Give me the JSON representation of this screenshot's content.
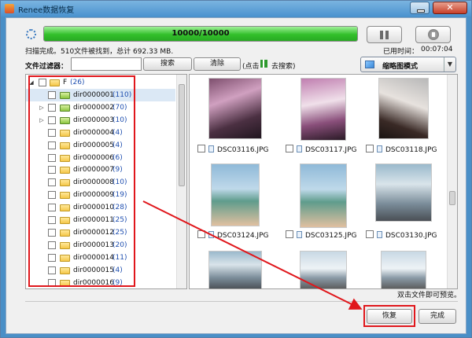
{
  "window": {
    "title": "Renee数据恢复",
    "close_label": "✕"
  },
  "progress": {
    "fraction": 1.0,
    "text": "10000/10000",
    "fill_color": "#33c02b"
  },
  "status": {
    "scan_text": "扫描完成。510文件被找到，总计 692.33 MB.",
    "elapsed_label": "已用时间：",
    "elapsed_value": "00:07:04"
  },
  "filter": {
    "label": "文件过滤器：",
    "input_value": "",
    "search_label": "搜索",
    "clear_label": "清除",
    "hint_open": "(点击",
    "hint_close": "去搜索)"
  },
  "view": {
    "mode_label": "缩略图模式"
  },
  "tree": {
    "root": {
      "name": "F",
      "count": "(26)"
    },
    "items": [
      {
        "name": "dir0000001",
        "count": "(110)",
        "expander": "",
        "special": true
      },
      {
        "name": "dir0000002",
        "count": "(70)",
        "expander": "▷",
        "special": true
      },
      {
        "name": "dir0000003",
        "count": "(10)",
        "expander": "▷",
        "special": true
      },
      {
        "name": "dir0000004",
        "count": "(4)",
        "expander": "",
        "special": false
      },
      {
        "name": "dir0000005",
        "count": "(4)",
        "expander": "",
        "special": false
      },
      {
        "name": "dir0000006",
        "count": "(6)",
        "expander": "",
        "special": false
      },
      {
        "name": "dir0000007",
        "count": "(9)",
        "expander": "",
        "special": false
      },
      {
        "name": "dir0000008",
        "count": "(10)",
        "expander": "",
        "special": false
      },
      {
        "name": "dir0000009",
        "count": "(19)",
        "expander": "",
        "special": false
      },
      {
        "name": "dir0000010",
        "count": "(28)",
        "expander": "",
        "special": false
      },
      {
        "name": "dir0000011",
        "count": "(25)",
        "expander": "",
        "special": false
      },
      {
        "name": "dir0000012",
        "count": "(25)",
        "expander": "",
        "special": false
      },
      {
        "name": "dir0000013",
        "count": "(20)",
        "expander": "",
        "special": false
      },
      {
        "name": "dir0000014",
        "count": "(11)",
        "expander": "",
        "special": false
      },
      {
        "name": "dir0000015",
        "count": "(4)",
        "expander": "",
        "special": false
      },
      {
        "name": "dir0000016",
        "count": "(9)",
        "expander": "",
        "special": false
      }
    ]
  },
  "gallery": {
    "rows": [
      [
        {
          "name": "DSC03116.JPG",
          "variant": "v1"
        },
        {
          "name": "DSC03117.JPG",
          "variant": "v2"
        },
        {
          "name": "DSC03118.JPG",
          "variant": "v3"
        }
      ],
      [
        {
          "name": "DSC03124.JPG",
          "variant": "v4"
        },
        {
          "name": "DSC03125.JPG",
          "variant": "v4"
        },
        {
          "name": "DSC03130.JPG",
          "variant": "v5"
        }
      ],
      [
        {
          "name": "",
          "variant": "v5"
        },
        {
          "name": "",
          "variant": "v6"
        },
        {
          "name": "",
          "variant": "v6"
        }
      ]
    ],
    "hint": "双击文件即可预览。"
  },
  "actions": {
    "recover_label": "恢复",
    "finish_label": "完成"
  },
  "annotation_color": "#e0171c"
}
